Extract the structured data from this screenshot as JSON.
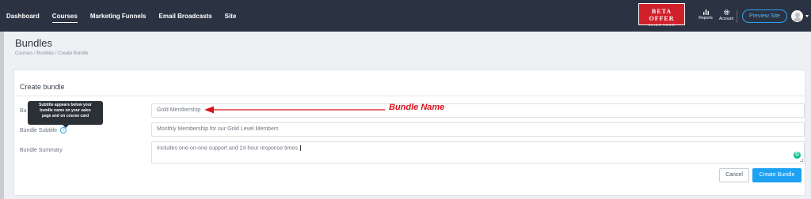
{
  "nav": {
    "items": [
      "Dashboard",
      "Courses",
      "Marketing Funnels",
      "Email Broadcasts",
      "Site"
    ],
    "active": "Courses"
  },
  "beta": {
    "title": "BETA OFFER",
    "sub": "CLICK HERE"
  },
  "tools": {
    "reports": "Reports",
    "account": "Account",
    "preview": "Preview Site"
  },
  "header": {
    "title": "Bundles",
    "breadcrumb": "Courses / Bundles / Create Bundle"
  },
  "form": {
    "title": "Create bundle",
    "name_label": "Bu",
    "name_value": "Gold Membership",
    "subtitle_label": "Bundle Subtitle",
    "subtitle_value": "Monthly Membership for our Gold Level Members",
    "summary_label": "Bundle Summary",
    "summary_value": "Includes one-on-one support and 24 hour response times.",
    "cancel": "Cancel",
    "create": "Create Bundle"
  },
  "tooltip": {
    "lines": [
      "Subtitle appears below your",
      "bundle name on your sales",
      "page and on course card"
    ]
  },
  "annotation": {
    "text": "Bundle Name"
  },
  "colors": {
    "topbar": "#2b3343",
    "accent": "#1da1f2",
    "beta": "#d0202a",
    "annotation": "#d9141c"
  },
  "icons": [
    "reports-icon",
    "gear-icon",
    "user-avatar-icon",
    "info-icon",
    "grammarly-icon",
    "arrow-left-icon"
  ]
}
